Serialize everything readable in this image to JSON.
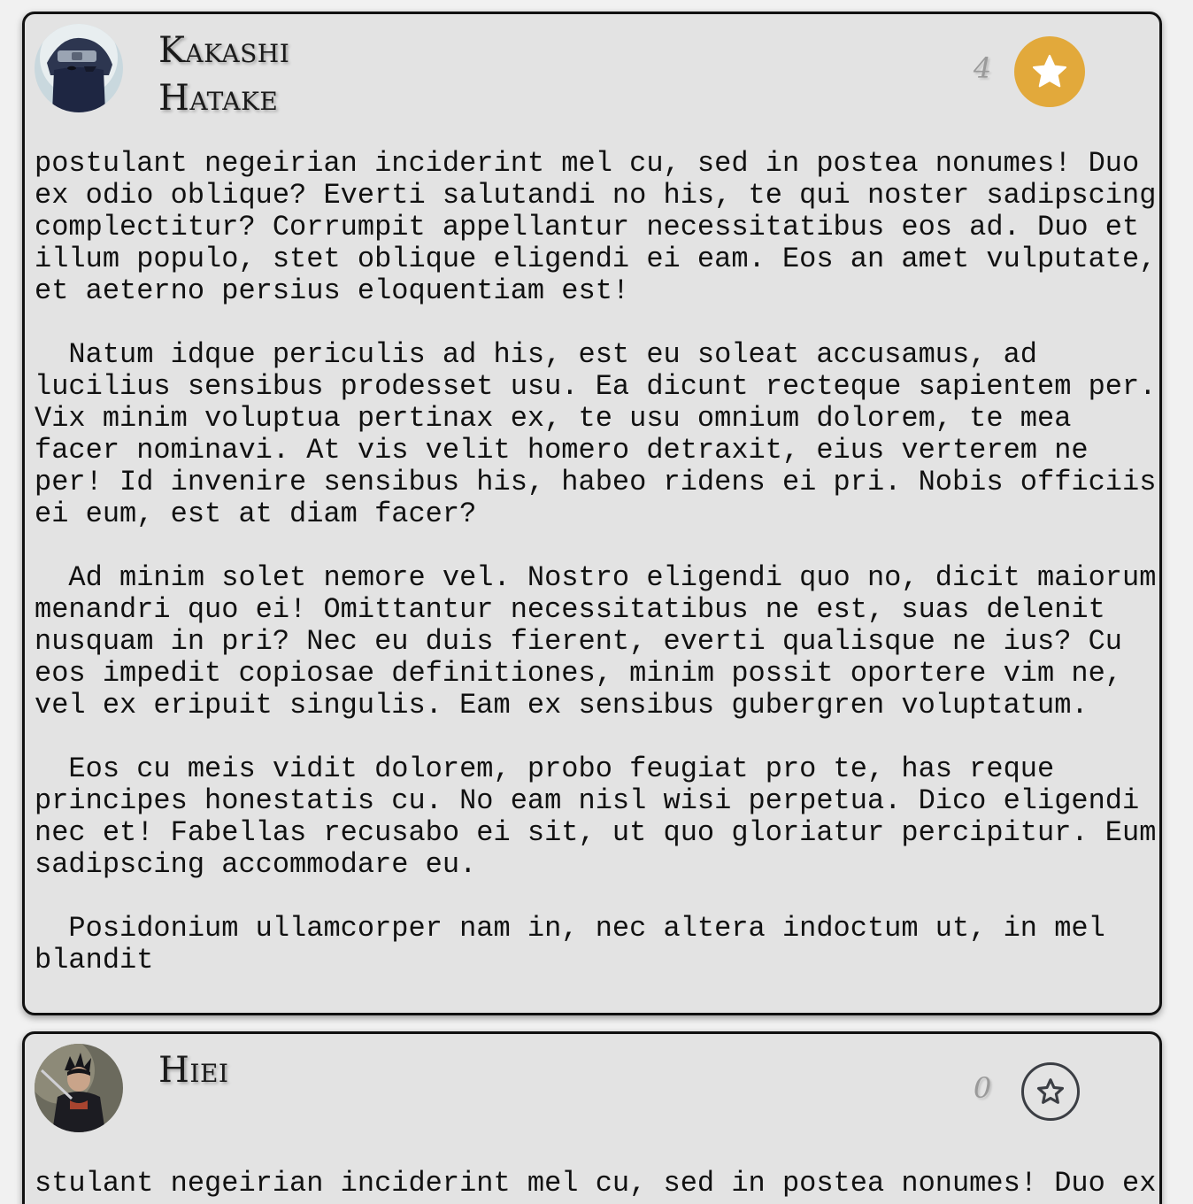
{
  "posts": [
    {
      "author": "Kakashi Hatake",
      "likes": "4",
      "starred": true,
      "body": "postulant negeirian inciderint mel cu, sed in postea nonumes! Duo ex odio oblique? Everti salutandi no his, te qui noster sadipscing complectitur? Corrumpit appellantur necessitatibus eos ad. Duo et illum populo, stet oblique eligendi ei eam. Eos an amet vulputate, et aeterno persius eloquentiam est!\n\n  Natum idque periculis ad his, est eu soleat accusamus, ad lucilius sensibus prodesset usu. Ea dicunt recteque sapientem per. Vix minim voluptua pertinax ex, te usu omnium dolorem, te mea facer nominavi. At vis velit homero detraxit, eius verterem ne per! Id invenire sensibus his, habeo ridens ei pri. Nobis officiis ei eum, est at diam facer?\n\n  Ad minim solet nemore vel. Nostro eligendi quo no, dicit maiorum menandri quo ei! Omittantur necessitatibus ne est, suas delenit nusquam in pri? Nec eu duis fierent, everti qualisque ne ius? Cu eos impedit copiosae definitiones, minim possit oportere vim ne, vel ex eripuit singulis. Eam ex sensibus gubergren voluptatum.\n\n  Eos cu meis vidit dolorem, probo feugiat pro te, has reque principes honestatis cu. No eam nisl wisi perpetua. Dico eligendi nec et! Fabellas recusabo ei sit, ut quo gloriatur percipitur. Eum sadipscing accommodare eu.\n\n  Posidonium ullamcorper nam in, nec altera indoctum ut, in mel blandit"
    },
    {
      "author": "Hiei",
      "likes": "0",
      "starred": false,
      "body": "stulant negeirian inciderint mel cu, sed in postea nonumes! Duo ex"
    }
  ],
  "icons": {
    "star": "star-icon",
    "avatar": "avatar-image"
  },
  "colors": {
    "card_bg": "#e3e3e3",
    "star_filled": "#e2a93b",
    "star_outline": "#3b3e44",
    "count": "#9a9a9a"
  }
}
